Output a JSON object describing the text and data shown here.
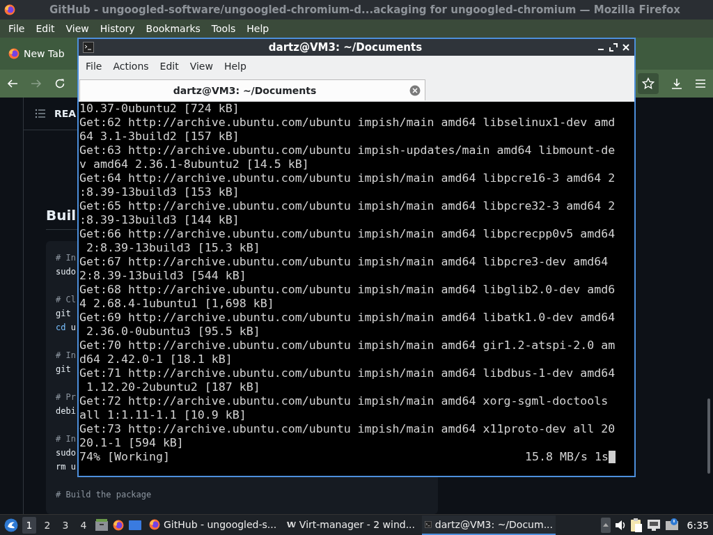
{
  "browser": {
    "title": "GitHub - ungoogled-software/ungoogled-chromium-d...ackaging for ungoogled-chromium — Mozilla Firefox",
    "menu": [
      "File",
      "Edit",
      "View",
      "History",
      "Bookmarks",
      "Tools",
      "Help"
    ],
    "tab": {
      "label": "New Tab"
    },
    "page": {
      "toc_label": "REA",
      "heading": "Buil",
      "code_groups": [
        [
          {
            "kind": "comment",
            "text": "# In"
          },
          {
            "kind": "command",
            "text": "sudo"
          }
        ],
        [
          {
            "kind": "comment",
            "text": "# Cl"
          },
          {
            "kind": "command",
            "text": "git"
          },
          {
            "kind": "builtin",
            "text": "cd",
            "rest": " u"
          }
        ],
        [
          {
            "kind": "comment",
            "text": "# In"
          },
          {
            "kind": "command",
            "text": "git"
          }
        ],
        [
          {
            "kind": "comment",
            "text": "# Pr"
          },
          {
            "kind": "command",
            "text": "debi"
          }
        ],
        [
          {
            "kind": "comment",
            "text": "# In"
          },
          {
            "kind": "command",
            "text": "sudo"
          },
          {
            "kind": "command",
            "text": "rm u"
          }
        ],
        [
          {
            "kind": "comment",
            "text": "# Build the package"
          }
        ]
      ]
    }
  },
  "terminal": {
    "title": "dartz@VM3: ~/Documents",
    "menu": [
      "File",
      "Actions",
      "Edit",
      "View",
      "Help"
    ],
    "tab": {
      "title": "dartz@VM3: ~/Documents",
      "selected": true
    },
    "lines": [
      "10.37-0ubuntu2 [724 kB]",
      "Get:62 http://archive.ubuntu.com/ubuntu impish/main amd64 libselinux1-dev amd",
      "64 3.1-3build2 [157 kB]",
      "Get:63 http://archive.ubuntu.com/ubuntu impish-updates/main amd64 libmount-de",
      "v amd64 2.36.1-8ubuntu2 [14.5 kB]",
      "Get:64 http://archive.ubuntu.com/ubuntu impish/main amd64 libpcre16-3 amd64 2",
      ":8.39-13build3 [153 kB]",
      "Get:65 http://archive.ubuntu.com/ubuntu impish/main amd64 libpcre32-3 amd64 2",
      ":8.39-13build3 [144 kB]",
      "Get:66 http://archive.ubuntu.com/ubuntu impish/main amd64 libpcrecpp0v5 amd64",
      " 2:8.39-13build3 [15.3 kB]",
      "Get:67 http://archive.ubuntu.com/ubuntu impish/main amd64 libpcre3-dev amd64",
      "2:8.39-13build3 [544 kB]",
      "Get:68 http://archive.ubuntu.com/ubuntu impish/main amd64 libglib2.0-dev amd6",
      "4 2.68.4-1ubuntu1 [1,698 kB]",
      "Get:69 http://archive.ubuntu.com/ubuntu impish/main amd64 libatk1.0-dev amd64",
      " 2.36.0-0ubuntu3 [95.5 kB]",
      "Get:70 http://archive.ubuntu.com/ubuntu impish/main amd64 gir1.2-atspi-2.0 am",
      "d64 2.42.0-1 [18.1 kB]",
      "Get:71 http://archive.ubuntu.com/ubuntu impish/main amd64 libdbus-1-dev amd64",
      " 1.12.20-2ubuntu2 [187 kB]",
      "Get:72 http://archive.ubuntu.com/ubuntu impish/main amd64 xorg-sgml-doctools",
      "all 1:1.11-1.1 [10.9 kB]",
      "Get:73 http://archive.ubuntu.com/ubuntu impish/main amd64 x11proto-dev all 20",
      "20.1-1 [594 kB]"
    ],
    "status": {
      "progress": "74% [Working]",
      "rate": "15.8 MB/s 1s"
    }
  },
  "taskbar": {
    "workspaces": [
      {
        "label": "1",
        "selected": true
      },
      {
        "label": "2",
        "selected": false
      },
      {
        "label": "3",
        "selected": false
      },
      {
        "label": "4",
        "selected": false
      }
    ],
    "tasks": [
      {
        "kind": "browser",
        "label": "GitHub - ungoogled-s...",
        "active": false
      },
      {
        "kind": "virt",
        "label": "Virt-manager - 2 wind...",
        "active": false
      },
      {
        "kind": "terminal",
        "label": "dartz@VM3: ~/Docum...",
        "active": true
      }
    ],
    "clock": "6:35"
  }
}
